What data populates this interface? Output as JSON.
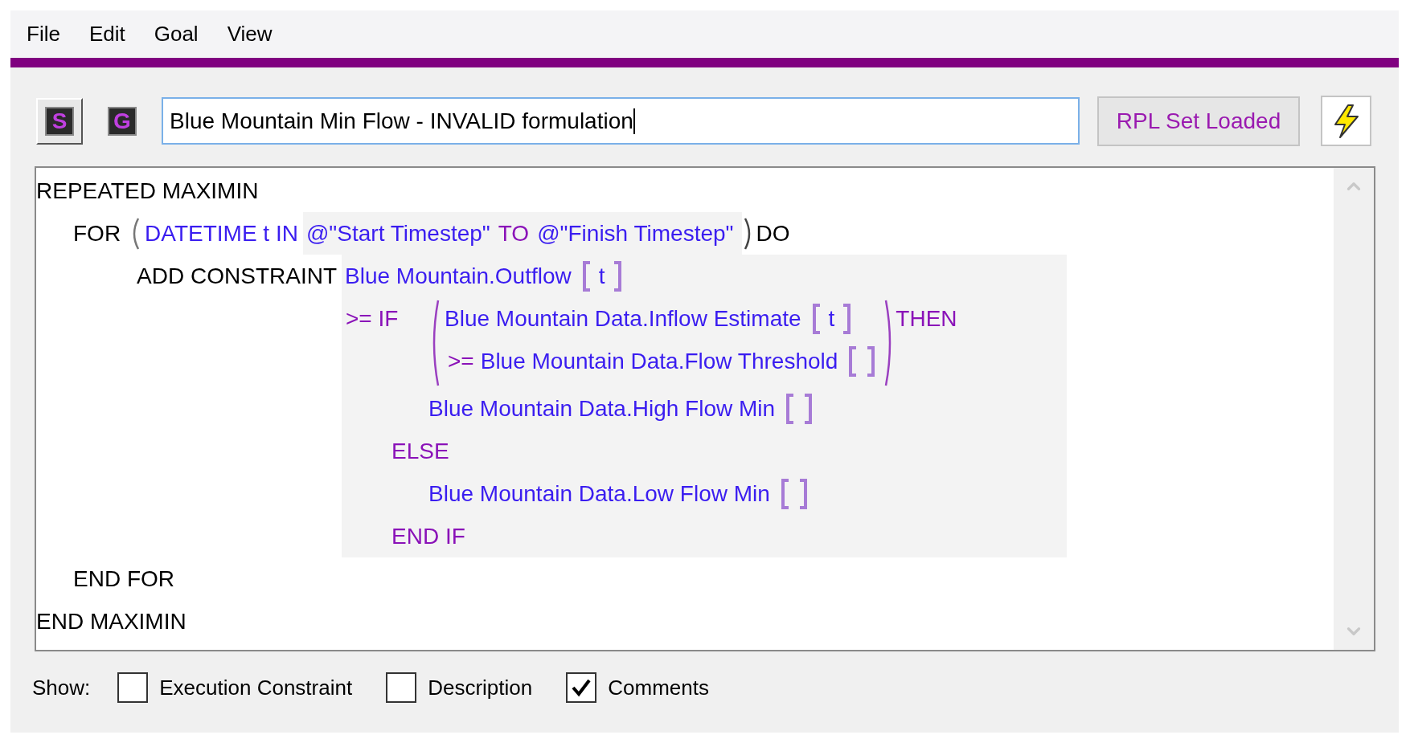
{
  "menu": [
    {
      "label": "File"
    },
    {
      "label": "Edit"
    },
    {
      "label": "Goal"
    },
    {
      "label": "View"
    }
  ],
  "toolbar": {
    "tool_buttons": [
      {
        "label": "S",
        "pressed": true
      },
      {
        "label": "G",
        "pressed": false
      }
    ],
    "title_field": {
      "value": "Blue Mountain Min Flow - INVALID formulation",
      "focused": true
    },
    "status_button": "RPL Set Loaded"
  },
  "editor": {
    "header": "REPEATED MAXIMIN",
    "for_line": {
      "keyword": "FOR",
      "variable": "DATETIME t IN",
      "start": "@\"Start Timestep\"",
      "to": "TO",
      "end": "@\"Finish Timestep\"",
      "do": "DO"
    },
    "constraint": {
      "keyword": "ADD CONSTRAINT",
      "target": {
        "slot": "Blue Mountain.Outflow",
        "index": "t"
      },
      "if": ">= IF",
      "condition": [
        {
          "slot": "Blue Mountain Data.Inflow Estimate",
          "index": "t"
        },
        {
          "op": ">=",
          "slot": "Blue Mountain Data.Flow Threshold"
        }
      ],
      "then": "THEN",
      "then_value": {
        "slot": "Blue Mountain Data.High Flow Min"
      },
      "else": "ELSE",
      "else_value": {
        "slot": "Blue Mountain Data.Low Flow Min"
      },
      "end_if": "END IF"
    },
    "end_for": "END FOR",
    "footer": "END MAXIMIN"
  },
  "show": {
    "label": "Show:",
    "options": [
      {
        "label": "Execution Constraint",
        "checked": false
      },
      {
        "label": "Description",
        "checked": false
      },
      {
        "label": "Comments",
        "checked": true
      }
    ]
  }
}
